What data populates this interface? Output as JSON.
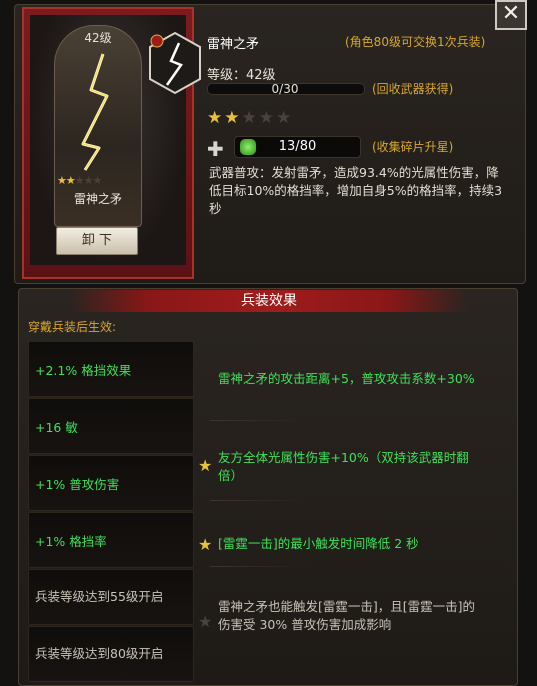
{
  "weapon": {
    "name": "雷神之矛",
    "card_level": "42级",
    "card_stars": {
      "filled": 2,
      "total": 5
    },
    "unequip_label": "卸 下",
    "exchange_note": "(角色80级可交换1次兵装)",
    "level_label": "等级：42级",
    "xp_text": "0/30",
    "xp_progress": 0,
    "recycle_note": "(回收武器获得)",
    "stars": {
      "filled": 2,
      "total": 5
    },
    "fragments_text": "13/80",
    "fragments_note": "(收集碎片升星)",
    "skill_description": "武器普攻：发射雷矛，造成93.4%的光属性伤害，降低目标10%的格挡率，增加自身5%的格挡率，持续3秒"
  },
  "close_icon": "close-icon",
  "effects": {
    "title": "兵装效果",
    "subtitle": "穿戴兵装后生效:",
    "rows": [
      {
        "label": "+2.1% 格挡效果",
        "active": true
      },
      {
        "label": "+16 敏",
        "active": true
      },
      {
        "label": "+1% 普攻伤害",
        "active": true
      },
      {
        "label": "+1% 格挡率",
        "active": true
      },
      {
        "label": "兵装等级达到55级开启",
        "active": false
      },
      {
        "label": "兵装等级达到80级开启",
        "active": false
      }
    ],
    "descriptions": [
      {
        "text": "雷神之矛的攻击距离+5，普攻攻击系数+30%",
        "active": true
      },
      {
        "text": "友方全体光属性伤害+10%（双持该武器时翻倍）",
        "active": true
      },
      {
        "text": "[雷霆一击]的最小触发时间降低 2 秒",
        "active": true
      },
      {
        "text": "雷神之矛也能触发[雷霆一击]，且[雷霆一击]的伤害受 30% 普攻伤害加成影响",
        "active": false
      }
    ]
  },
  "colors": {
    "accent_gold": "#d7a82b",
    "active_green": "#3ee05a",
    "banner_red": "#7a1c1f",
    "star_gold": "#e7c23a"
  }
}
